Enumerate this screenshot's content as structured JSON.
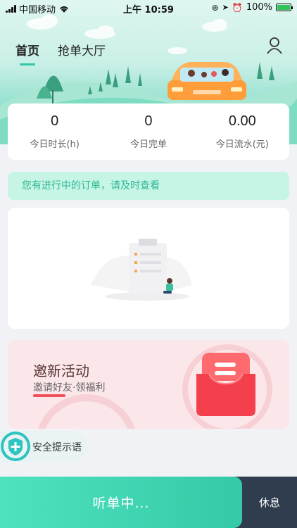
{
  "status_bar": {
    "carrier": "中国移动",
    "time": "上午 10:59",
    "battery": "100%"
  },
  "tabs": [
    {
      "label": "首页",
      "active": true
    },
    {
      "label": "抢单大厅",
      "active": false
    }
  ],
  "stats": [
    {
      "value": "0",
      "label": "今日时长(h)"
    },
    {
      "value": "0",
      "label": "今日完单"
    },
    {
      "value": "0.00",
      "label": "今日流水(元)"
    }
  ],
  "notice": "您有进行中的订单，请及时查看",
  "promo": {
    "title": "邀新活动",
    "subtitle": "邀请好友·领福利"
  },
  "safety_label": "安全提示语",
  "bottom": {
    "listen_label": "听单中...",
    "rest_label": "休息"
  },
  "colors": {
    "accent": "#35c9a7",
    "notice_bg": "#c7f5e5",
    "promo_bg": "#fbe7e9",
    "promo_red": "#f0505a",
    "rest_bg": "#2f3d4f"
  },
  "icons": {
    "user": "user-icon",
    "wifi": "wifi-icon",
    "shield": "shield-plus-icon",
    "empty": "empty-orders-illustration",
    "inbox": "inbox-icon"
  }
}
